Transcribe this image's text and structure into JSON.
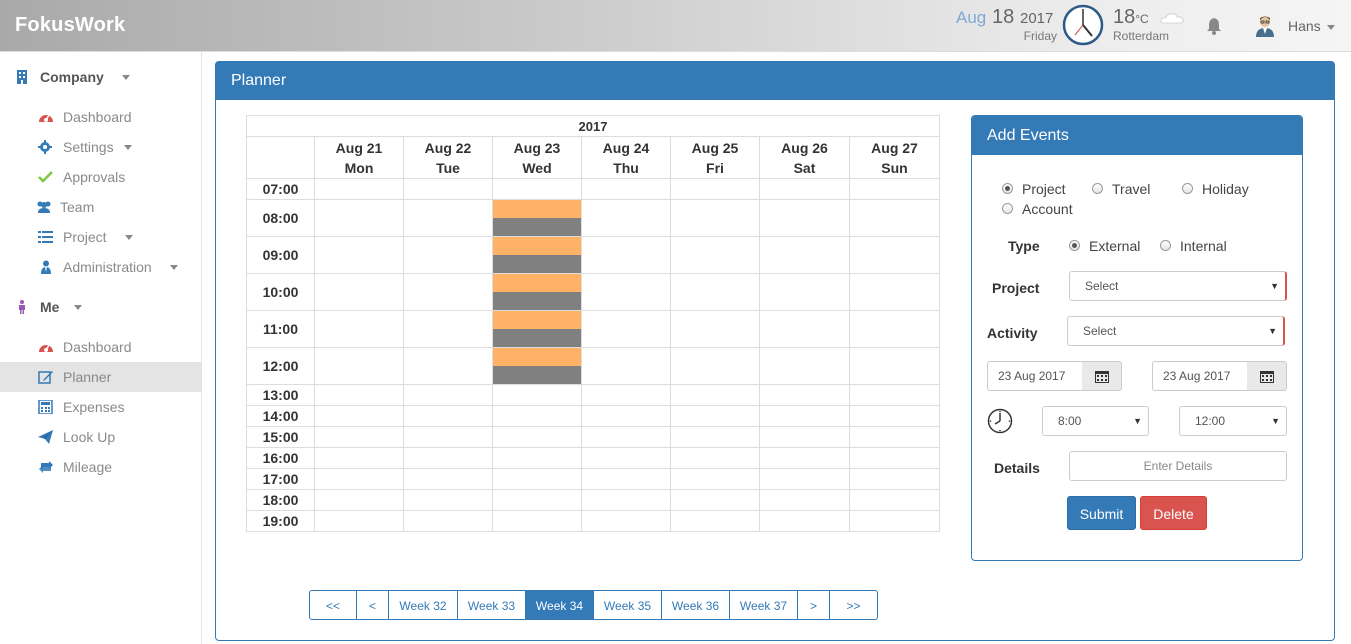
{
  "app": {
    "brand": "FokusWork"
  },
  "header": {
    "date_month": "Aug",
    "date_day": "18",
    "date_year": "2017",
    "date_weekday": "Friday",
    "temperature": "18",
    "temp_unit": "°C",
    "city": "Rotterdam",
    "user_name": "Hans"
  },
  "sidebar": {
    "sections": [
      {
        "label": "Company",
        "icon": "building-icon",
        "items": [
          {
            "label": "Dashboard",
            "icon": "dashboard-icon"
          },
          {
            "label": "Settings",
            "icon": "gear-icon"
          },
          {
            "label": "Approvals",
            "icon": "check-icon"
          },
          {
            "label": "Team",
            "icon": "users-icon"
          },
          {
            "label": "Project",
            "icon": "list-icon"
          },
          {
            "label": "Administration",
            "icon": "user-tie-icon"
          }
        ]
      },
      {
        "label": "Me",
        "icon": "person-icon",
        "items": [
          {
            "label": "Dashboard",
            "icon": "dashboard-icon"
          },
          {
            "label": "Planner",
            "icon": "edit-icon",
            "active": true
          },
          {
            "label": "Expenses",
            "icon": "calculator-icon"
          },
          {
            "label": "Look Up",
            "icon": "paper-plane-icon"
          },
          {
            "label": "Mileage",
            "icon": "retweet-icon"
          }
        ]
      }
    ]
  },
  "planner": {
    "title": "Planner",
    "year": "2017",
    "days": [
      {
        "date": "Aug 21",
        "weekday": "Mon"
      },
      {
        "date": "Aug 22",
        "weekday": "Tue"
      },
      {
        "date": "Aug 23",
        "weekday": "Wed"
      },
      {
        "date": "Aug 24",
        "weekday": "Thu"
      },
      {
        "date": "Aug 25",
        "weekday": "Fri"
      },
      {
        "date": "Aug 26",
        "weekday": "Sat"
      },
      {
        "date": "Aug 27",
        "weekday": "Sun"
      }
    ],
    "hours": [
      "07:00",
      "08:00",
      "09:00",
      "10:00",
      "11:00",
      "12:00",
      "13:00",
      "14:00",
      "15:00",
      "16:00",
      "17:00",
      "18:00",
      "19:00"
    ],
    "event_colors": {
      "primary": "#ffb266",
      "secondary": "#808080"
    }
  },
  "add_events": {
    "title": "Add Events",
    "event_types": [
      "Project",
      "Travel",
      "Holiday",
      "Account"
    ],
    "selected_event_type": "Project",
    "type_label": "Type",
    "type_options": [
      "External",
      "Internal"
    ],
    "selected_type": "External",
    "project_label": "Project",
    "project_value": "Select",
    "activity_label": "Activity",
    "activity_value": "Select",
    "start_date": "23 Aug 2017",
    "end_date": "23 Aug 2017",
    "start_time": "8:00",
    "end_time": "12:00",
    "details_label": "Details",
    "details_placeholder": "Enter Details",
    "submit_label": "Submit",
    "delete_label": "Delete"
  },
  "pagination": {
    "first": "<<",
    "prev": "<",
    "weeks": [
      "Week 32",
      "Week 33",
      "Week 34",
      "Week 35",
      "Week 36",
      "Week 37"
    ],
    "active_week": "Week 34",
    "next": ">",
    "last": ">>"
  },
  "colors": {
    "primary": "#337ab7",
    "danger": "#d9534f",
    "event_orange": "#ffb266",
    "event_gray": "#808080"
  }
}
